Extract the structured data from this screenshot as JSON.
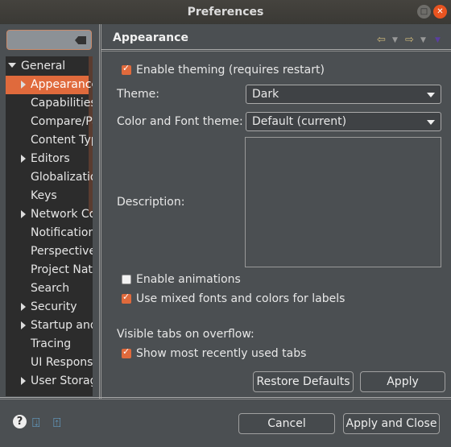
{
  "window": {
    "title": "Preferences"
  },
  "sidebar": {
    "search_placeholder": "",
    "items": [
      {
        "label": "General",
        "expander": "expanded"
      },
      {
        "label": "Appearance",
        "expander": "collapsed",
        "selected": true
      },
      {
        "label": "Capabilities",
        "expander": "none"
      },
      {
        "label": "Compare/Patch",
        "expander": "none"
      },
      {
        "label": "Content Types",
        "expander": "none"
      },
      {
        "label": "Editors",
        "expander": "collapsed"
      },
      {
        "label": "Globalization",
        "expander": "none"
      },
      {
        "label": "Keys",
        "expander": "none"
      },
      {
        "label": "Network Connections",
        "expander": "collapsed"
      },
      {
        "label": "Notifications",
        "expander": "none"
      },
      {
        "label": "Perspectives",
        "expander": "none"
      },
      {
        "label": "Project Natures",
        "expander": "none"
      },
      {
        "label": "Search",
        "expander": "none"
      },
      {
        "label": "Security",
        "expander": "collapsed"
      },
      {
        "label": "Startup and Shutdown",
        "expander": "collapsed"
      },
      {
        "label": "Tracing",
        "expander": "none"
      },
      {
        "label": "UI Responsiveness",
        "expander": "none"
      },
      {
        "label": "User Storage",
        "expander": "collapsed"
      }
    ]
  },
  "page": {
    "title": "Appearance",
    "enable_theming": {
      "label": "Enable theming (requires restart)",
      "checked": true
    },
    "theme": {
      "label": "Theme:",
      "value": "Dark"
    },
    "color_font_theme": {
      "label": "Color and Font theme:",
      "value": "Default (current)"
    },
    "description": {
      "label": "Description:",
      "value": ""
    },
    "enable_animations": {
      "label": "Enable animations",
      "checked": false
    },
    "mixed_fonts": {
      "label": "Use mixed fonts and colors for labels",
      "checked": true
    },
    "visible_tabs_label": "Visible tabs on overflow:",
    "show_mru": {
      "label": "Show most recently used tabs",
      "checked": true
    },
    "restore_defaults": "Restore Defaults",
    "apply": "Apply"
  },
  "footer": {
    "cancel": "Cancel",
    "apply_and_close": "Apply and Close"
  },
  "colors": {
    "accent": "#e06a3c",
    "background": "#4b4f52",
    "tree_bg": "#2c2c2c"
  }
}
